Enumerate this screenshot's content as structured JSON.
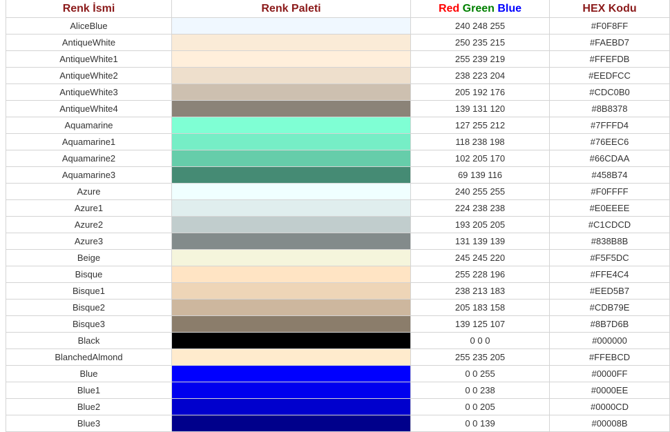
{
  "header": {
    "name": "Renk İsmi",
    "palette": "Renk Paleti",
    "rgb_red": "Red",
    "rgb_green": "Green",
    "rgb_blue": "Blue",
    "hex": "HEX Kodu"
  },
  "colors": [
    {
      "name": "AliceBlue",
      "rgb": "240 248 255",
      "hex": "#F0F8FF"
    },
    {
      "name": "AntiqueWhite",
      "rgb": "250 235 215",
      "hex": "#FAEBD7"
    },
    {
      "name": "AntiqueWhite1",
      "rgb": "255 239 219",
      "hex": "#FFEFDB"
    },
    {
      "name": "AntiqueWhite2",
      "rgb": "238 223 204",
      "hex": "#EEDFCC"
    },
    {
      "name": "AntiqueWhite3",
      "rgb": "205 192 176",
      "hex": "#CDC0B0"
    },
    {
      "name": "AntiqueWhite4",
      "rgb": "139 131 120",
      "hex": "#8B8378"
    },
    {
      "name": "Aquamarine",
      "rgb": "127 255 212",
      "hex": "#7FFFD4"
    },
    {
      "name": "Aquamarine1",
      "rgb": "118 238 198",
      "hex": "#76EEC6"
    },
    {
      "name": "Aquamarine2",
      "rgb": "102 205 170",
      "hex": "#66CDAA"
    },
    {
      "name": "Aquamarine3",
      "rgb": "69 139 116",
      "hex": "#458B74"
    },
    {
      "name": "Azure",
      "rgb": "240 255 255",
      "hex": "#F0FFFF"
    },
    {
      "name": "Azure1",
      "rgb": "224 238 238",
      "hex": "#E0EEEE"
    },
    {
      "name": "Azure2",
      "rgb": "193 205 205",
      "hex": "#C1CDCD"
    },
    {
      "name": "Azure3",
      "rgb": "131 139 139",
      "hex": "#838B8B"
    },
    {
      "name": "Beige",
      "rgb": "245 245 220",
      "hex": "#F5F5DC"
    },
    {
      "name": "Bisque",
      "rgb": "255 228 196",
      "hex": "#FFE4C4"
    },
    {
      "name": "Bisque1",
      "rgb": "238 213 183",
      "hex": "#EED5B7"
    },
    {
      "name": "Bisque2",
      "rgb": "205 183 158",
      "hex": "#CDB79E"
    },
    {
      "name": "Bisque3",
      "rgb": "139 125 107",
      "hex": "#8B7D6B"
    },
    {
      "name": "Black",
      "rgb": "0 0 0",
      "hex": "#000000"
    },
    {
      "name": "BlanchedAlmond",
      "rgb": "255 235 205",
      "hex": "#FFEBCD"
    },
    {
      "name": "Blue",
      "rgb": "0 0 255",
      "hex": "#0000FF"
    },
    {
      "name": "Blue1",
      "rgb": "0 0 238",
      "hex": "#0000EE"
    },
    {
      "name": "Blue2",
      "rgb": "0 0 205",
      "hex": "#0000CD"
    },
    {
      "name": "Blue3",
      "rgb": "0 0 139",
      "hex": "#00008B"
    }
  ]
}
